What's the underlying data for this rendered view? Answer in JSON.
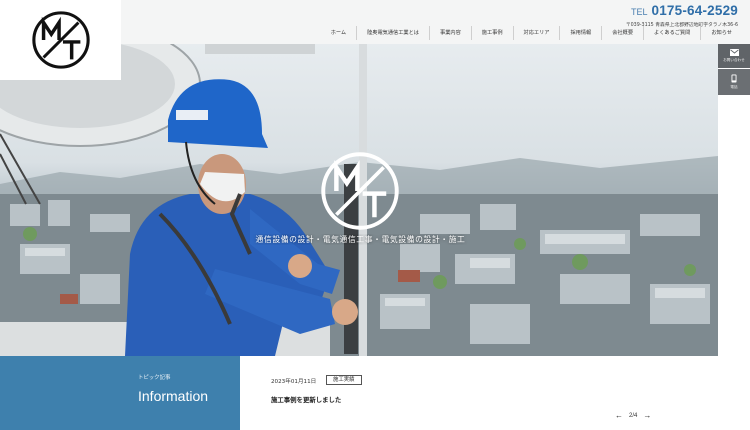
{
  "header": {
    "tel_label": "TEL",
    "tel_number": "0175-64-2529",
    "address": "〒039-3115 青森県上北郡野辺地町字タラノ木36-6"
  },
  "nav": {
    "items": [
      {
        "label": "ホーム"
      },
      {
        "label": "陸奥電気通信工業とは"
      },
      {
        "label": "事業内容"
      },
      {
        "label": "施工事例"
      },
      {
        "label": "対応エリア"
      },
      {
        "label": "採用情報"
      },
      {
        "label": "会社概要"
      },
      {
        "label": "よくあるご質問"
      },
      {
        "label": "お知らせ"
      }
    ]
  },
  "hero": {
    "caption": "通信設備の設計・電気通信工事・電気設備の設計・施工"
  },
  "side": {
    "mail_label": "お問い合わせ",
    "phone_label": "電話"
  },
  "info": {
    "eyebrow": "トピック記事",
    "title": "Information"
  },
  "news": {
    "date": "2023年01月11日",
    "tag": "施工実績",
    "headline": "施工事例を更新しました",
    "pager": "2/4",
    "prev_icon": "arrow-left-icon",
    "next_icon": "arrow-right-icon"
  },
  "colors": {
    "accent_blue": "#3e80ad",
    "tel_blue": "#2f6ea8",
    "side_gray": "#606468"
  }
}
